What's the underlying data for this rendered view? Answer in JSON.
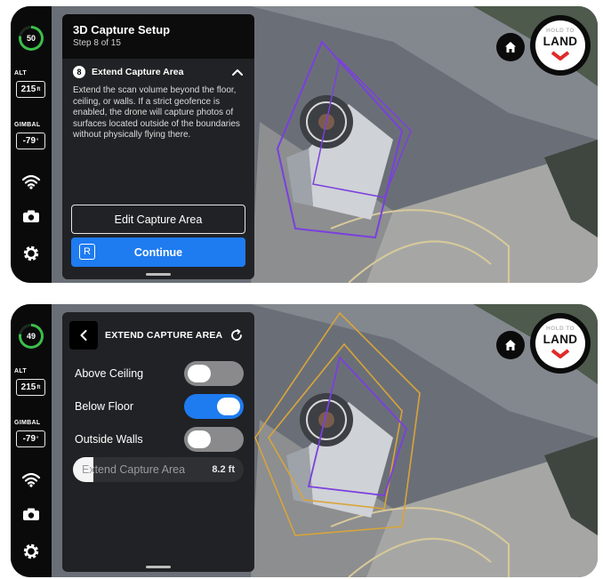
{
  "screens": [
    {
      "rail": {
        "battery_percent": "50",
        "alt_label": "ALT",
        "alt_value": "215",
        "alt_unit": "ft",
        "gimbal_label": "GIMBAL",
        "gimbal_value": "-79",
        "gimbal_unit": "°"
      },
      "panel": {
        "title": "3D Capture Setup",
        "step": "Step 8 of 15",
        "section_number": "8",
        "section_title": "Extend Capture Area",
        "description": "Extend the scan volume beyond the floor, ceiling, or walls. If a strict geofence is enabled, the drone will capture photos of surfaces located outside of the boundaries without physically flying there.",
        "edit_button": "Edit Capture Area",
        "continue_badge": "R",
        "continue_button": "Continue"
      },
      "land_button": {
        "small_text": "HOLD TO",
        "big_text": "LAND"
      }
    },
    {
      "rail": {
        "battery_percent": "49",
        "alt_label": "ALT",
        "alt_value": "215",
        "alt_unit": "ft",
        "gimbal_label": "GIMBAL",
        "gimbal_value": "-79",
        "gimbal_unit": "°"
      },
      "panel": {
        "title": "EXTEND CAPTURE AREA",
        "toggles": [
          {
            "label": "Above Ceiling",
            "state": "off"
          },
          {
            "label": "Below Floor",
            "state": "on"
          },
          {
            "label": "Outside Walls",
            "state": "off"
          }
        ],
        "slider_label": "Extend Capture Area",
        "slider_value": "8.2 ft",
        "slider_level_percent": 12
      },
      "land_button": {
        "small_text": "HOLD TO",
        "big_text": "LAND"
      }
    }
  ],
  "colors": {
    "accent_blue": "#1e7bf0",
    "battery_green": "#3bbf4a",
    "panel_bg": "#212225",
    "boundary_purple": "#7b3fe0",
    "boundary_yellow": "#d9a43a",
    "land_chevron_red": "#e02a2a"
  },
  "icons": [
    "wifi-icon",
    "camera-icon",
    "gear-icon",
    "home-icon",
    "chevron-up-icon",
    "back-chevron-icon",
    "reset-icon",
    "chevron-down-icon"
  ]
}
